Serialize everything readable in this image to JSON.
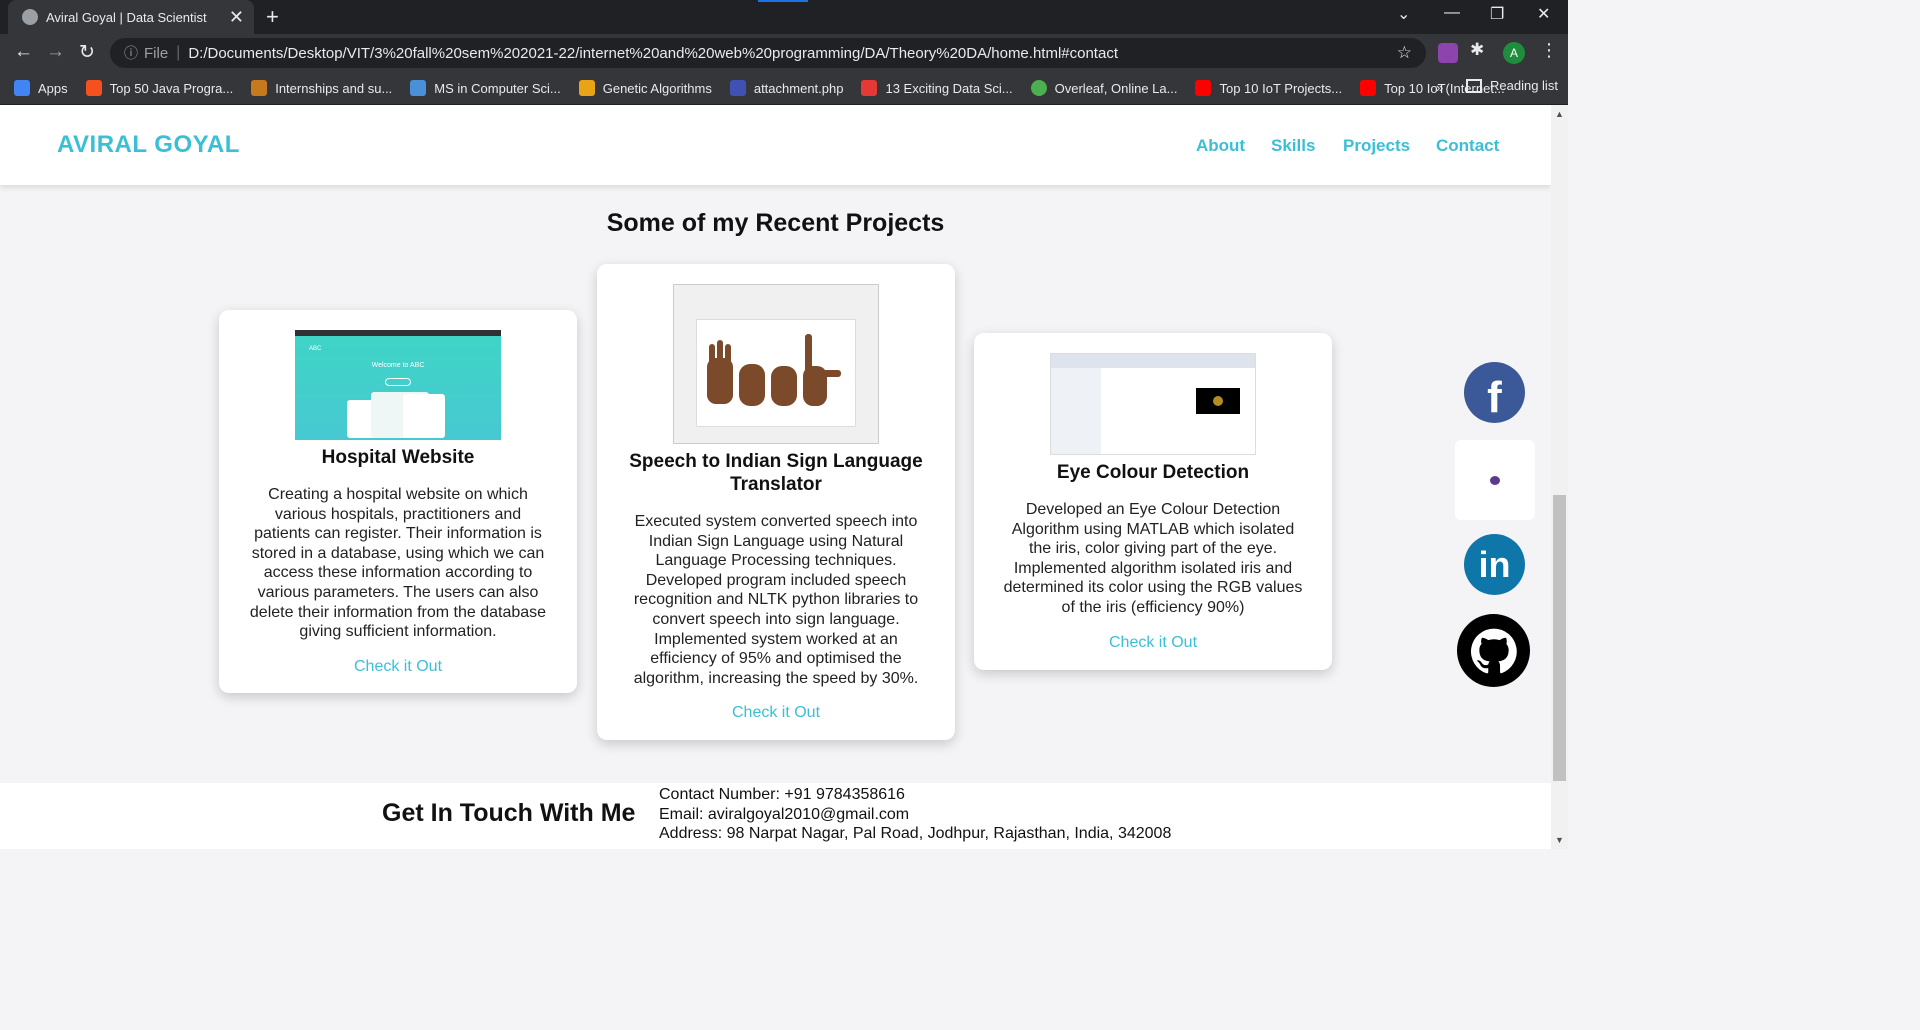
{
  "browser": {
    "tab_title": "Aviral Goyal | Data Scientist",
    "url_scheme": "File",
    "url": "D:/Documents/Desktop/VIT/3%20fall%20sem%202021-22/internet%20and%20web%20programming/DA/Theory%20DA/home.html#contact",
    "profile_initial": "A",
    "bookmarks": [
      {
        "label": "Apps",
        "color": "#4285f4"
      },
      {
        "label": "Top 50 Java Progra...",
        "color": "#f4511e"
      },
      {
        "label": "Internships and su...",
        "color": "#c77a1d"
      },
      {
        "label": "MS in Computer Sci...",
        "color": "#4a90d9"
      },
      {
        "label": "Genetic Algorithms",
        "color": "#e8a317"
      },
      {
        "label": "attachment.php",
        "color": "#3f51b5"
      },
      {
        "label": "13 Exciting Data Sci...",
        "color": "#e53935"
      },
      {
        "label": "Overleaf, Online La...",
        "color": "#4caf50"
      },
      {
        "label": "Top 10 IoT Projects...",
        "color": "#ff0000"
      },
      {
        "label": "Top 10 IoT(Internet...",
        "color": "#ff0000"
      }
    ],
    "more": "»",
    "reading_list": "Reading list"
  },
  "site": {
    "brand": "AVIRAL GOYAL",
    "nav": [
      "About",
      "Skills",
      "Projects",
      "Contact"
    ],
    "projects_title": "Some of my Recent Projects",
    "projects": [
      {
        "title": "Hospital Website",
        "description": "Creating a hospital website on which various hospitals, practitioners and patients can register. Their information is stored in a database, using which we can access these information according to various parameters. The users can also delete their information from the database giving sufficient information.",
        "link": "Check it Out",
        "thumb_heading": "Welcome to ABC",
        "thumb_logo": "ABC"
      },
      {
        "title": "Speech to Indian Sign Language Translator",
        "description": "Executed system converted speech into Indian Sign Language using Natural Language Processing techniques. Developed program included speech recognition and NLTK python libraries to convert speech into sign language. Implemented system worked at an efficiency of 95% and optimised the algorithm, increasing the speed by 30%.",
        "link": "Check it Out"
      },
      {
        "title": "Eye Colour Detection",
        "description": "Developed an Eye Colour Detection Algorithm using MATLAB which isolated the iris, color giving part of the eye. Implemented algorithm isolated iris and determined its color using the RGB values of the iris (efficiency 90%)",
        "link": "Check it Out"
      }
    ],
    "contact_title": "Get In Touch With Me",
    "contact_lines": [
      "Contact Number: +91 9784358616",
      "Email: aviralgoyal2010@gmail.com",
      "Address: 98 Narpat Nagar, Pal Road, Jodhpur, Rajasthan, India, 342008"
    ],
    "colors": {
      "accent": "#3bbfd6",
      "facebook": "#3b5998",
      "linkedin": "#0e76a8",
      "github": "#000000"
    }
  }
}
